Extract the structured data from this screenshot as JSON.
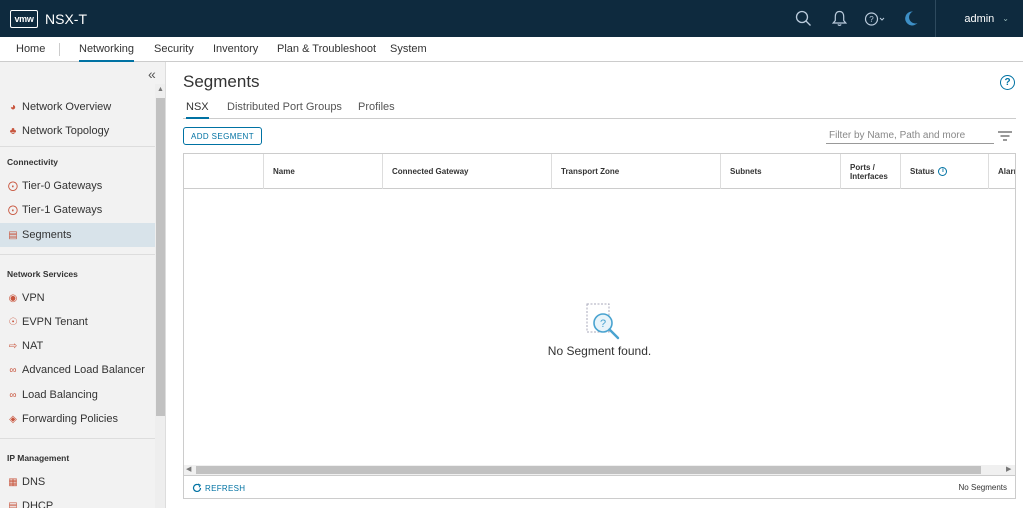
{
  "header": {
    "logo_text": "vmw",
    "app_title": "NSX-T",
    "user": "admin",
    "icons": [
      "search-icon",
      "bell-icon",
      "help-icon",
      "moon-icon"
    ]
  },
  "nav": {
    "tabs": [
      {
        "label": "Home"
      },
      {
        "label": "Networking",
        "active": true
      },
      {
        "label": "Security"
      },
      {
        "label": "Inventory"
      },
      {
        "label": "Plan & Troubleshoot"
      },
      {
        "label": "System"
      }
    ]
  },
  "sidebar": {
    "collapse_glyph": "«",
    "top_items": [
      {
        "label": "Network Overview",
        "icon": "gauge-icon"
      },
      {
        "label": "Network Topology",
        "icon": "topology-icon"
      }
    ],
    "sections": [
      {
        "heading": "Connectivity",
        "items": [
          {
            "label": "Tier-0 Gateways",
            "icon": "gateway-icon"
          },
          {
            "label": "Tier-1 Gateways",
            "icon": "gateway-icon"
          },
          {
            "label": "Segments",
            "icon": "segments-icon",
            "active": true
          }
        ]
      },
      {
        "heading": "Network Services",
        "items": [
          {
            "label": "VPN",
            "icon": "vpn-icon"
          },
          {
            "label": "EVPN Tenant",
            "icon": "evpn-icon"
          },
          {
            "label": "NAT",
            "icon": "nat-icon"
          },
          {
            "label": "Advanced Load Balancer",
            "icon": "load-balancer-icon"
          },
          {
            "label": "Load Balancing",
            "icon": "load-balancer-icon"
          },
          {
            "label": "Forwarding Policies",
            "icon": "forwarding-icon"
          }
        ]
      },
      {
        "heading": "IP Management",
        "items": [
          {
            "label": "DNS",
            "icon": "dns-icon"
          },
          {
            "label": "DHCP",
            "icon": "dhcp-icon"
          }
        ]
      }
    ]
  },
  "main": {
    "title": "Segments",
    "subtabs": [
      {
        "label": "NSX",
        "active": true
      },
      {
        "label": "Distributed Port Groups"
      },
      {
        "label": "Profiles"
      }
    ],
    "add_button": "ADD SEGMENT",
    "filter_placeholder": "Filter by Name, Path and more",
    "columns": [
      "",
      "Name",
      "Connected Gateway",
      "Transport Zone",
      "Subnets",
      "Ports / Interfaces",
      "Status",
      "Alarr"
    ],
    "empty_text": "No Segment found.",
    "refresh_label": "REFRESH",
    "footer_count": "No Segments"
  },
  "colors": {
    "header_bg": "#0e2a3e",
    "accent": "#0072a3",
    "sidebar_bg": "#f2f2f2",
    "sidebar_active": "#d8e3ea",
    "icon_red": "#c8553d"
  }
}
